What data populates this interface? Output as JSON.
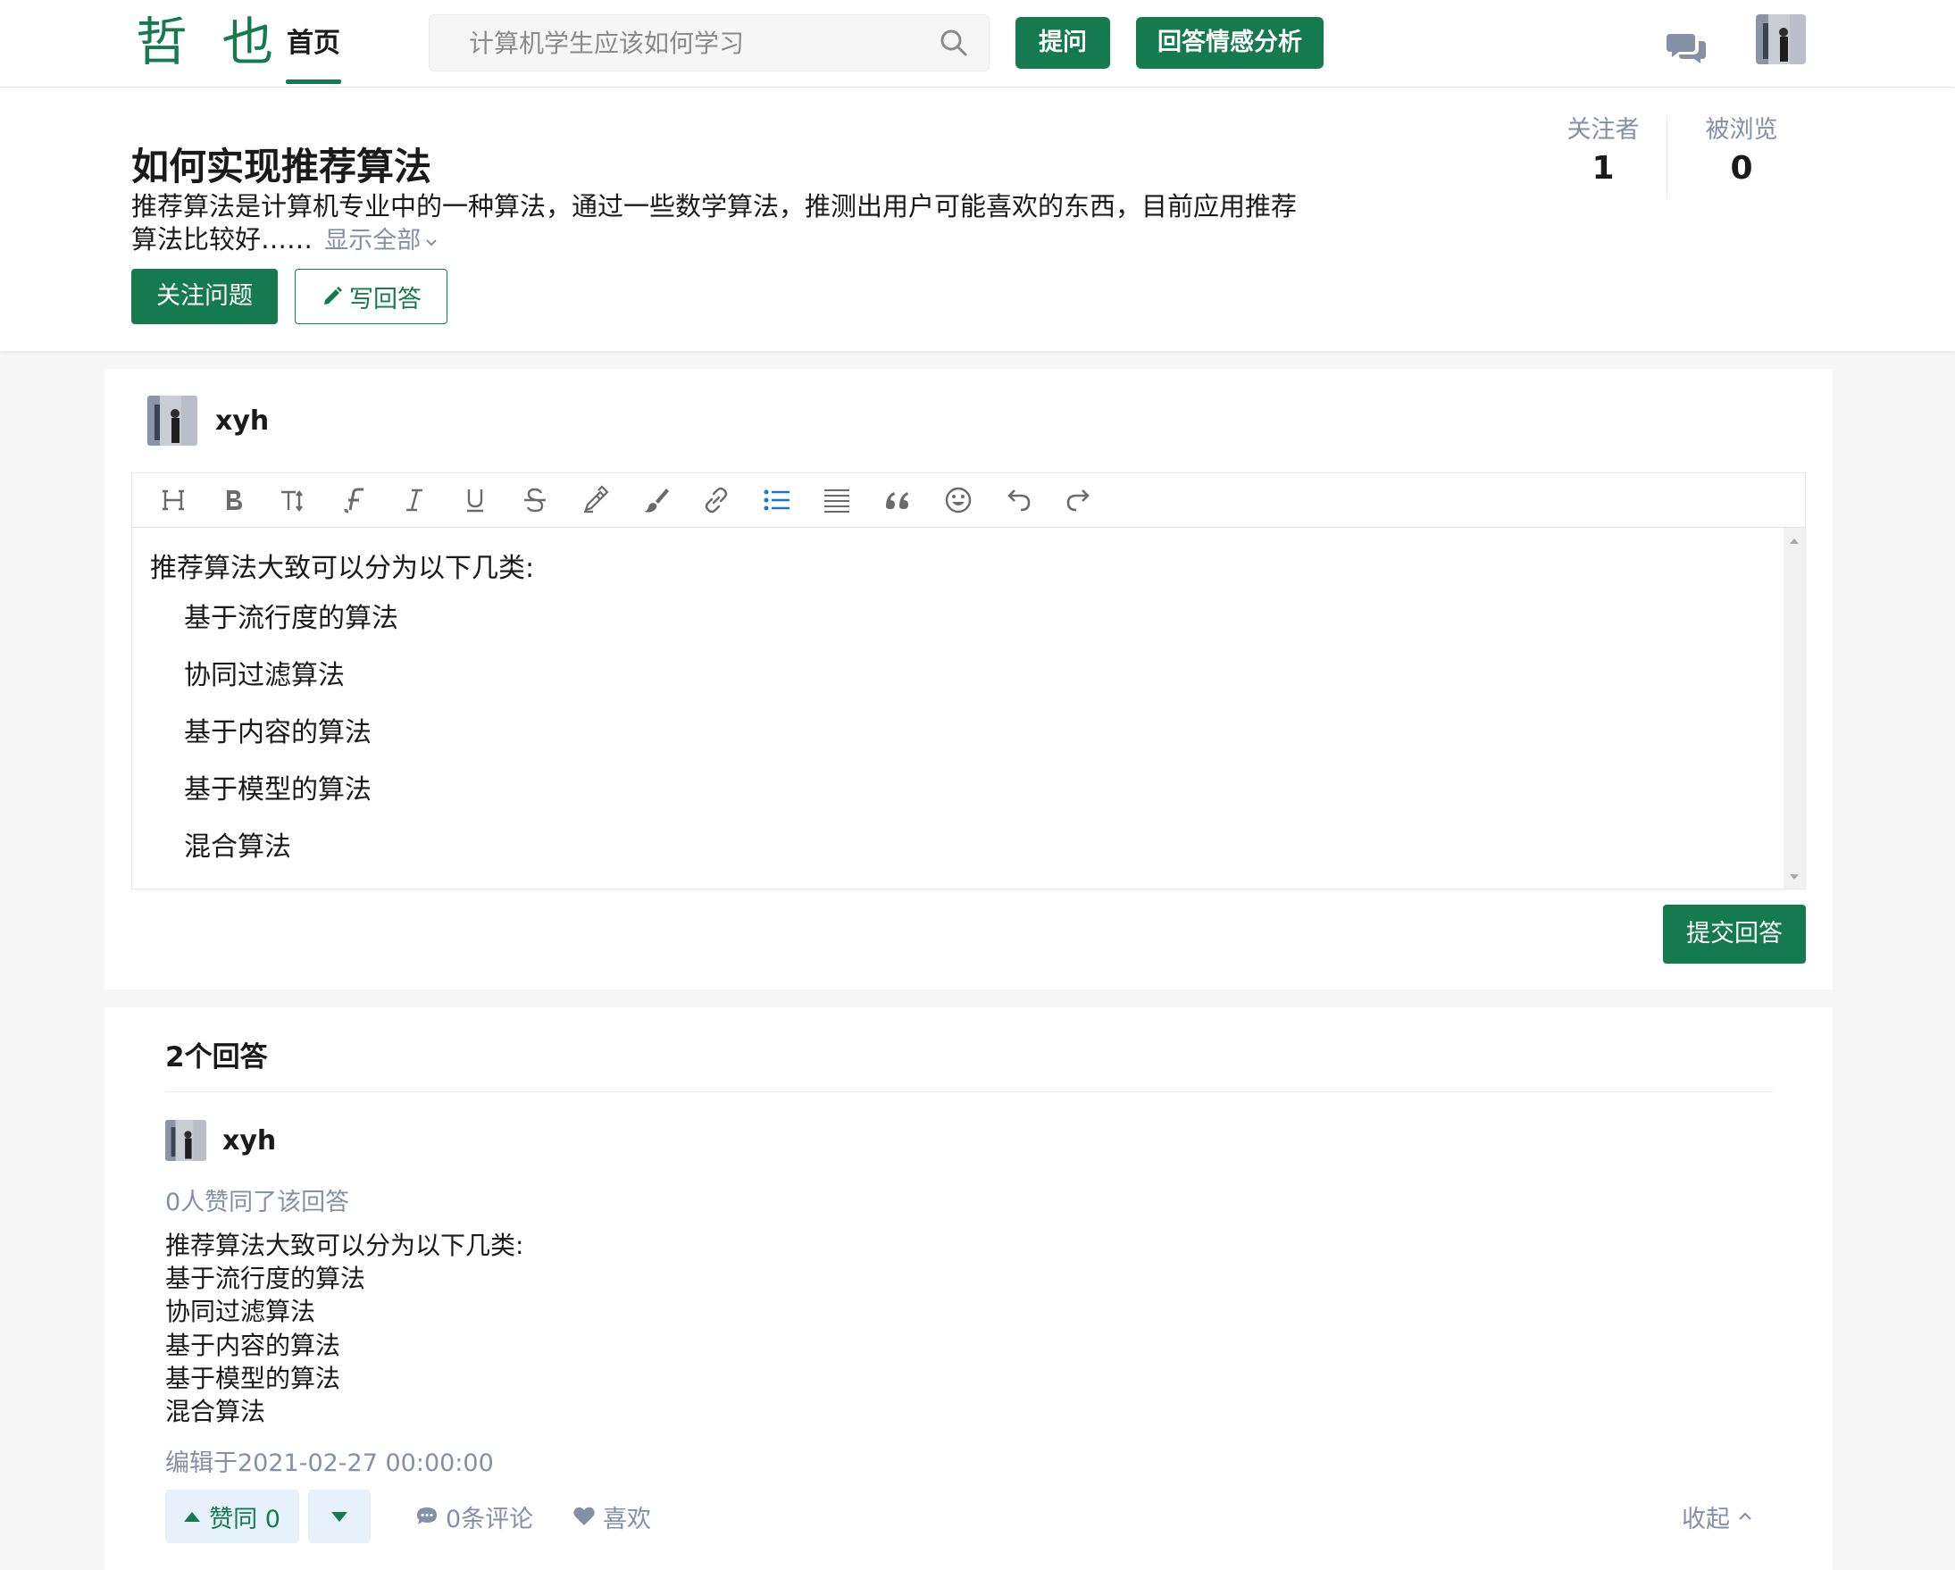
{
  "header": {
    "logo": "哲 也",
    "nav_home": "首页",
    "search_placeholder": "计算机学生应该如何学习",
    "ask_button": "提问",
    "analysis_button": "回答情感分析"
  },
  "question": {
    "title": "如何实现推荐算法",
    "description": "推荐算法是计算机专业中的一种算法，通过一些数学算法，推测出用户可能喜欢的东西，目前应用推荐算法比较好……",
    "show_all": "显示全部",
    "follow_button": "关注问题",
    "write_button": "写回答",
    "stats": {
      "followers_label": "关注者",
      "followers_value": "1",
      "views_label": "被浏览",
      "views_value": "0"
    }
  },
  "editor": {
    "username": "xyh",
    "toolbar_icons": [
      "heading-icon",
      "bold-icon",
      "font-size-icon",
      "font-family-icon",
      "italic-icon",
      "underline-icon",
      "strikethrough-icon",
      "highlight-icon",
      "color-brush-icon",
      "link-icon",
      "bullet-list-icon",
      "align-icon",
      "quote-icon",
      "emoji-icon",
      "undo-icon",
      "redo-icon"
    ],
    "intro": "推荐算法大致可以分为以下几类:",
    "items": [
      "基于流行度的算法",
      "协同过滤算法",
      "基于内容的算法",
      "基于模型的算法",
      "混合算法"
    ],
    "submit_button": "提交回答"
  },
  "answers": {
    "count_label": "2个回答",
    "first": {
      "username": "xyh",
      "votes_text": "0人赞同了该回答",
      "lines": [
        "推荐算法大致可以分为以下几类:",
        "基于流行度的算法",
        "协同过滤算法",
        "基于内容的算法",
        "基于模型的算法",
        "混合算法"
      ],
      "edited": "编辑于2021-02-27 00:00:00",
      "upvote_label": "赞同 0",
      "comments_label": "0条评论",
      "like_label": "喜欢",
      "collapse_label": "收起"
    }
  },
  "colors": {
    "brand_green": "#157a4f",
    "muted_text": "#8590a6",
    "vote_bg": "#e7f1fb"
  }
}
